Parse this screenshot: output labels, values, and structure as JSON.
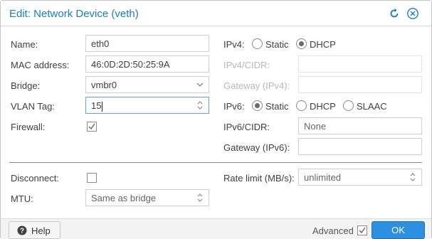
{
  "window": {
    "title": "Edit: Network Device (veth)"
  },
  "left": {
    "name_label": "Name:",
    "name_value": "eth0",
    "mac_label": "MAC address:",
    "mac_value": "46:0D:2D:50:25:9A",
    "bridge_label": "Bridge:",
    "bridge_value": "vmbr0",
    "vlan_label": "VLAN Tag:",
    "vlan_value": "15",
    "firewall_label": "Firewall:",
    "firewall_checked": true
  },
  "right": {
    "ipv4_label": "IPv4:",
    "ipv4_static": "Static",
    "ipv4_dhcp": "DHCP",
    "ipv4_selected": "DHCP",
    "ipv4_cidr_label": "IPv4/CIDR:",
    "ipv4_cidr_value": "",
    "ipv4_gw_label": "Gateway (IPv4):",
    "ipv4_gw_value": "",
    "ipv6_label": "IPv6:",
    "ipv6_static": "Static",
    "ipv6_dhcp": "DHCP",
    "ipv6_slaac": "SLAAC",
    "ipv6_selected": "Static",
    "ipv6_cidr_label": "IPv6/CIDR:",
    "ipv6_cidr_value": "None",
    "ipv6_gw_label": "Gateway (IPv6):",
    "ipv6_gw_value": ""
  },
  "advanced": {
    "disconnect_label": "Disconnect:",
    "disconnect_checked": false,
    "mtu_label": "MTU:",
    "mtu_value": "Same as bridge",
    "rate_label": "Rate limit (MB/s):",
    "rate_value": "unlimited"
  },
  "footer": {
    "help_label": "Help",
    "advanced_label": "Advanced",
    "advanced_checked": true,
    "ok_label": "OK"
  },
  "colors": {
    "accent": "#157fcc",
    "ok_button": "#2d8fe0"
  },
  "icons": [
    "reset-icon",
    "close-icon",
    "chevron-down-icon",
    "spinner-icon",
    "checkmark-icon",
    "help-icon"
  ]
}
